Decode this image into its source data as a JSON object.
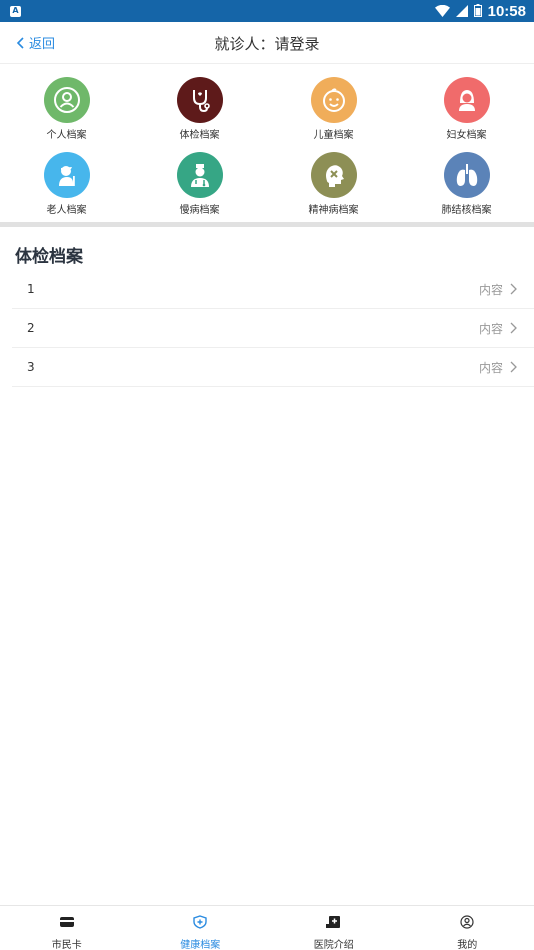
{
  "status_bar": {
    "time": "10:58",
    "app_glyph": "A"
  },
  "header": {
    "back_label": "返回",
    "title": "就诊人：请登录"
  },
  "categories": [
    {
      "label": "个人档案",
      "color": "#6fb86a",
      "icon": "person-icon"
    },
    {
      "label": "体检档案",
      "color": "#5e1a1a",
      "icon": "stethoscope-icon"
    },
    {
      "label": "儿童档案",
      "color": "#f0ad5a",
      "icon": "child-face-icon"
    },
    {
      "label": "妇女档案",
      "color": "#f06b6b",
      "icon": "woman-icon"
    },
    {
      "label": "老人档案",
      "color": "#47b6ec",
      "icon": "elderly-icon"
    },
    {
      "label": "慢病档案",
      "color": "#36a685",
      "icon": "doctor-icon"
    },
    {
      "label": "精神病档案",
      "color": "#8d8f55",
      "icon": "head-icon"
    },
    {
      "label": "肺结核档案",
      "color": "#5b83b8",
      "icon": "lungs-icon"
    }
  ],
  "section": {
    "title": "体检档案",
    "rows": [
      {
        "number": "1",
        "detail": "内容"
      },
      {
        "number": "2",
        "detail": "内容"
      },
      {
        "number": "3",
        "detail": "内容"
      }
    ]
  },
  "bottom_nav": [
    {
      "label": "市民卡",
      "icon": "card-icon",
      "active": false
    },
    {
      "label": "健康档案",
      "icon": "health-shield-icon",
      "active": true
    },
    {
      "label": "医院介绍",
      "icon": "hospital-icon",
      "active": false
    },
    {
      "label": "我的",
      "icon": "user-icon",
      "active": false
    }
  ],
  "colors": {
    "status_bar": "#1565a8",
    "accent": "#2a8be0"
  }
}
